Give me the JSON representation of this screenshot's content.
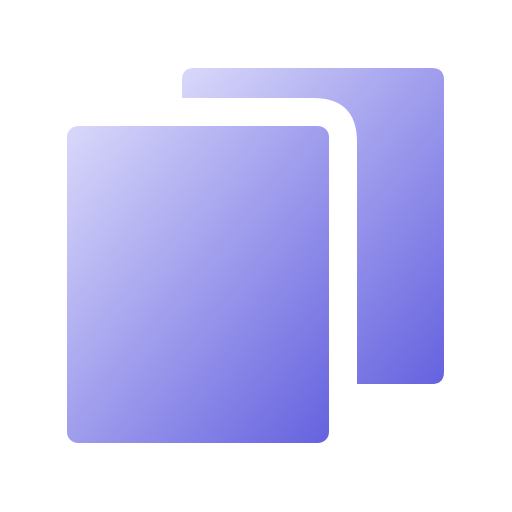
{
  "icon": {
    "name": "copy-icon",
    "colors": {
      "gradient_start": "#d9d8fa",
      "gradient_end": "#6562df",
      "background": "#ffffff"
    }
  }
}
